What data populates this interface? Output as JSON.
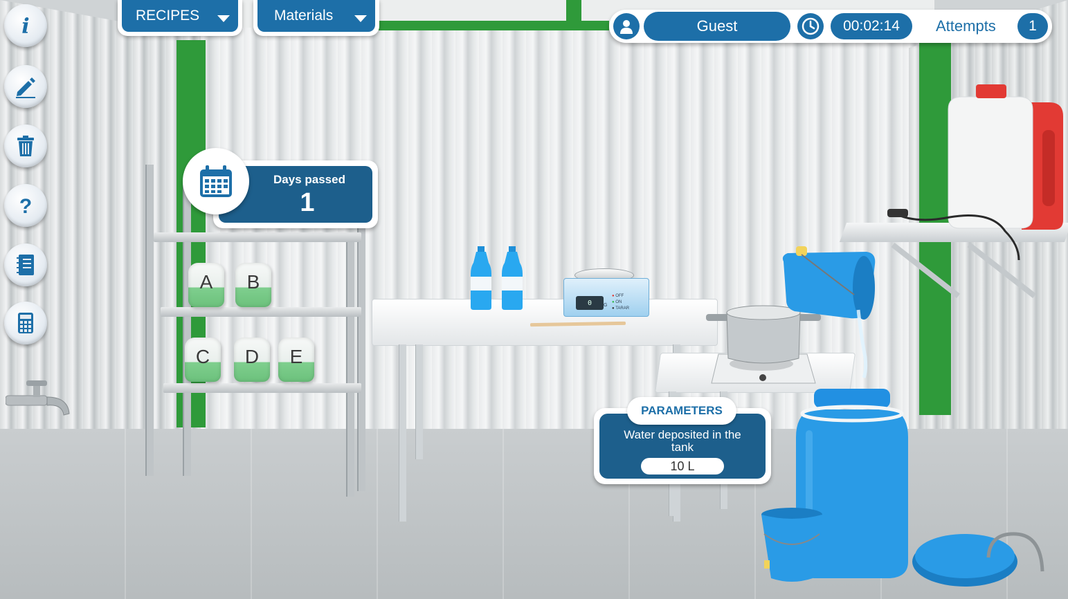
{
  "toolbar": {
    "buttons": [
      {
        "icon": "info-icon",
        "label": "i"
      },
      {
        "icon": "pencil-icon",
        "label": ""
      },
      {
        "icon": "trash-icon",
        "label": ""
      },
      {
        "icon": "help-icon",
        "label": "?"
      },
      {
        "icon": "notebook-icon",
        "label": ""
      },
      {
        "icon": "calculator-icon",
        "label": ""
      }
    ]
  },
  "menus": {
    "recipes_label": "RECIPES",
    "materials_label": "Materials"
  },
  "status": {
    "user_name": "Guest",
    "timer": "00:02:14",
    "attempts_label": "Attempts",
    "attempts_count": "1"
  },
  "days": {
    "label": "Days passed",
    "value": "1"
  },
  "parameters": {
    "title": "PARAMETERS",
    "description": "Water deposited in the tank",
    "value": "10 L"
  },
  "bags": [
    "A",
    "B",
    "C",
    "D",
    "E"
  ],
  "scale": {
    "display": "0",
    "unit": "G",
    "indicators": [
      "OFF",
      "ON",
      "TARAR"
    ]
  },
  "colors": {
    "primary_blue": "#1d6fa8",
    "card_blue": "#1d5f8c",
    "frame_green": "#2f9a3a",
    "container_blue": "#2a9be6",
    "jug_red": "#e23a34"
  }
}
